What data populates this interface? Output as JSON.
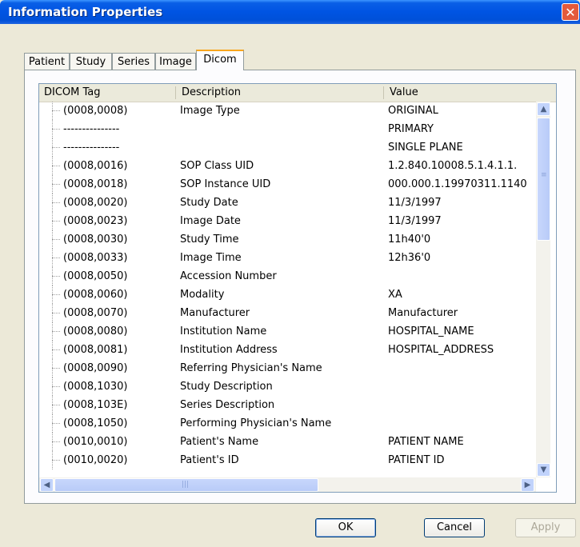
{
  "window": {
    "title": "Information Properties",
    "close_glyph": "✕"
  },
  "tabs": [
    {
      "label": "Patient"
    },
    {
      "label": "Study"
    },
    {
      "label": "Series"
    },
    {
      "label": "Image"
    },
    {
      "label": "Dicom"
    }
  ],
  "columns": {
    "tag": "DICOM Tag",
    "description": "Description",
    "value": "Value"
  },
  "rows": [
    {
      "tag": "(0008,0008)",
      "desc": "Image Type",
      "value": "ORIGINAL"
    },
    {
      "tag": "---------------",
      "desc": "",
      "value": "PRIMARY"
    },
    {
      "tag": "---------------",
      "desc": "",
      "value": "SINGLE PLANE"
    },
    {
      "tag": "(0008,0016)",
      "desc": "SOP Class UID",
      "value": "1.2.840.10008.5.1.4.1.1."
    },
    {
      "tag": "(0008,0018)",
      "desc": "SOP Instance UID",
      "value": "000.000.1.19970311.1140"
    },
    {
      "tag": "(0008,0020)",
      "desc": "Study Date",
      "value": "11/3/1997"
    },
    {
      "tag": "(0008,0023)",
      "desc": "Image Date",
      "value": "11/3/1997"
    },
    {
      "tag": "(0008,0030)",
      "desc": "Study Time",
      "value": "11h40'0"
    },
    {
      "tag": "(0008,0033)",
      "desc": "Image Time",
      "value": "12h36'0"
    },
    {
      "tag": "(0008,0050)",
      "desc": "Accession Number",
      "value": ""
    },
    {
      "tag": "(0008,0060)",
      "desc": "Modality",
      "value": "XA"
    },
    {
      "tag": "(0008,0070)",
      "desc": "Manufacturer",
      "value": " Manufacturer"
    },
    {
      "tag": "(0008,0080)",
      "desc": "Institution Name",
      "value": "HOSPITAL_NAME"
    },
    {
      "tag": "(0008,0081)",
      "desc": "Institution Address",
      "value": "HOSPITAL_ADDRESS"
    },
    {
      "tag": "(0008,0090)",
      "desc": "Referring Physician's Name",
      "value": ""
    },
    {
      "tag": "(0008,1030)",
      "desc": "Study Description",
      "value": ""
    },
    {
      "tag": "(0008,103E)",
      "desc": "Series Description",
      "value": ""
    },
    {
      "tag": "(0008,1050)",
      "desc": "Performing Physician's Name",
      "value": ""
    },
    {
      "tag": "(0010,0010)",
      "desc": "Patient's Name",
      "value": "PATIENT NAME"
    },
    {
      "tag": "(0010,0020)",
      "desc": "Patient's ID",
      "value": "PATIENT ID"
    }
  ],
  "buttons": {
    "ok": "OK",
    "cancel": "Cancel",
    "apply": "Apply"
  },
  "icons": {
    "scroll_up": "up-arrow-icon",
    "scroll_down": "down-arrow-icon",
    "scroll_left": "left-arrow-icon",
    "scroll_right": "right-arrow-icon",
    "close": "close-icon"
  },
  "colors": {
    "titlebar": "#0054e3",
    "dialog_bg": "#ece9d8",
    "active_tab_accent": "#f8a61e",
    "close_button": "#e35a3c"
  }
}
